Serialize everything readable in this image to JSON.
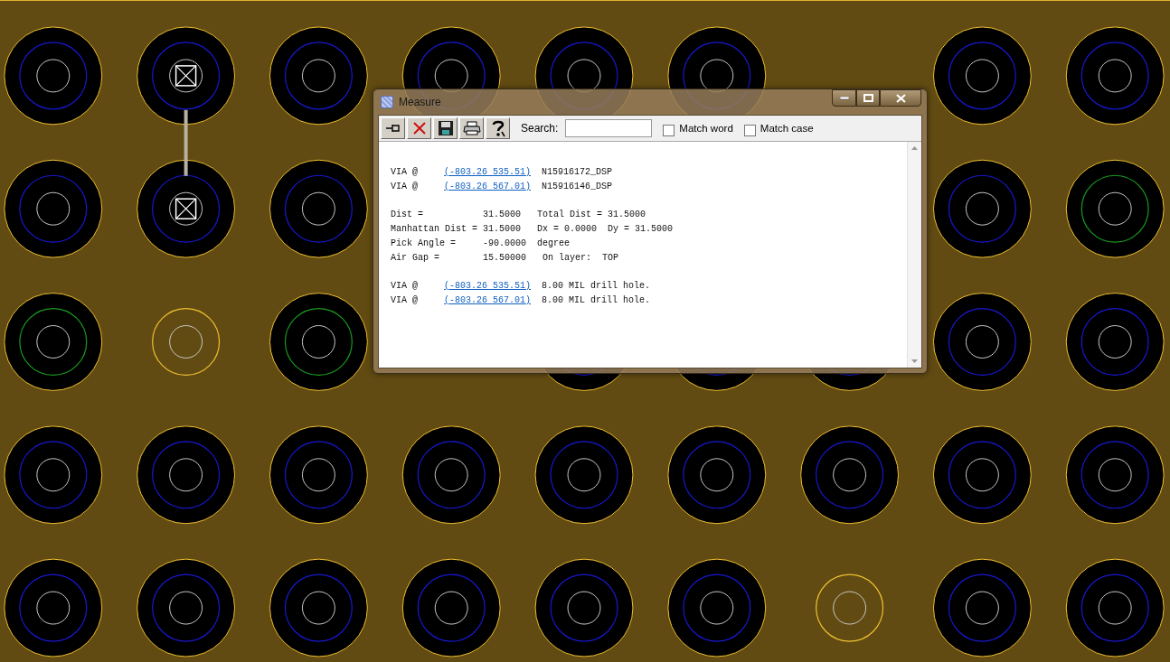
{
  "board": {
    "trace": true,
    "rows": [
      {
        "vias": [
          {
            "kind": "pad"
          },
          {
            "kind": "pad-marked"
          },
          {
            "kind": "pad"
          },
          {
            "kind": "pad"
          },
          {
            "kind": "pad"
          },
          {
            "kind": "pad"
          },
          {
            "kind": "none"
          },
          {
            "kind": "pad"
          },
          {
            "kind": "pad"
          }
        ]
      },
      {
        "vias": [
          {
            "kind": "pad"
          },
          {
            "kind": "pad-marked"
          },
          {
            "kind": "pad"
          },
          {
            "kind": "none"
          },
          {
            "kind": "none"
          },
          {
            "kind": "none"
          },
          {
            "kind": "none"
          },
          {
            "kind": "pad"
          },
          {
            "kind": "pad-green"
          }
        ]
      },
      {
        "vias": [
          {
            "kind": "pad-green"
          },
          {
            "kind": "ring"
          },
          {
            "kind": "pad-green"
          },
          {
            "kind": "none"
          },
          {
            "kind": "pad"
          },
          {
            "kind": "pad"
          },
          {
            "kind": "pad"
          },
          {
            "kind": "pad"
          },
          {
            "kind": "pad"
          }
        ]
      },
      {
        "vias": [
          {
            "kind": "pad"
          },
          {
            "kind": "pad"
          },
          {
            "kind": "pad"
          },
          {
            "kind": "pad"
          },
          {
            "kind": "pad"
          },
          {
            "kind": "pad"
          },
          {
            "kind": "pad"
          },
          {
            "kind": "pad"
          },
          {
            "kind": "pad"
          }
        ]
      },
      {
        "vias": [
          {
            "kind": "pad"
          },
          {
            "kind": "pad"
          },
          {
            "kind": "pad"
          },
          {
            "kind": "pad"
          },
          {
            "kind": "pad"
          },
          {
            "kind": "pad"
          },
          {
            "kind": "ring"
          },
          {
            "kind": "pad"
          },
          {
            "kind": "pad"
          }
        ]
      }
    ]
  },
  "window": {
    "title": "Measure",
    "toolbar": {
      "buttons": [
        {
          "kind": "pin"
        },
        {
          "kind": "delete"
        },
        {
          "kind": "save"
        },
        {
          "kind": "print"
        },
        {
          "kind": "help"
        }
      ],
      "search": {
        "label": "Search:"
      },
      "options": [
        {
          "label": "Match word",
          "checked": false
        },
        {
          "label": "Match case",
          "checked": false
        }
      ]
    },
    "sections": [
      [
        {
          "kind": "via",
          "label": "VIA @",
          "link": "(-803.26 535.51)",
          "info": "N15916172_DSP"
        },
        {
          "kind": "via",
          "label": "VIA @",
          "link": "(-803.26 567.01)",
          "info": "N15916146_DSP"
        }
      ],
      [
        {
          "kind": "text",
          "text": "Dist =           31.5000   Total Dist = 31.5000"
        },
        {
          "kind": "text",
          "text": "Manhattan Dist = 31.5000   Dx = 0.0000  Dy = 31.5000"
        },
        {
          "kind": "text",
          "text": "Pick Angle =     -90.0000  degree"
        },
        {
          "kind": "text",
          "text": "Air Gap =        15.50000   On layer:  TOP"
        }
      ],
      [
        {
          "kind": "via",
          "label": "VIA @",
          "link": "(-803.26 535.51)",
          "info": "8.00 MIL drill hole."
        },
        {
          "kind": "via",
          "label": "VIA @",
          "link": "(-803.26 567.01)",
          "info": "8.00 MIL drill hole."
        }
      ]
    ]
  }
}
